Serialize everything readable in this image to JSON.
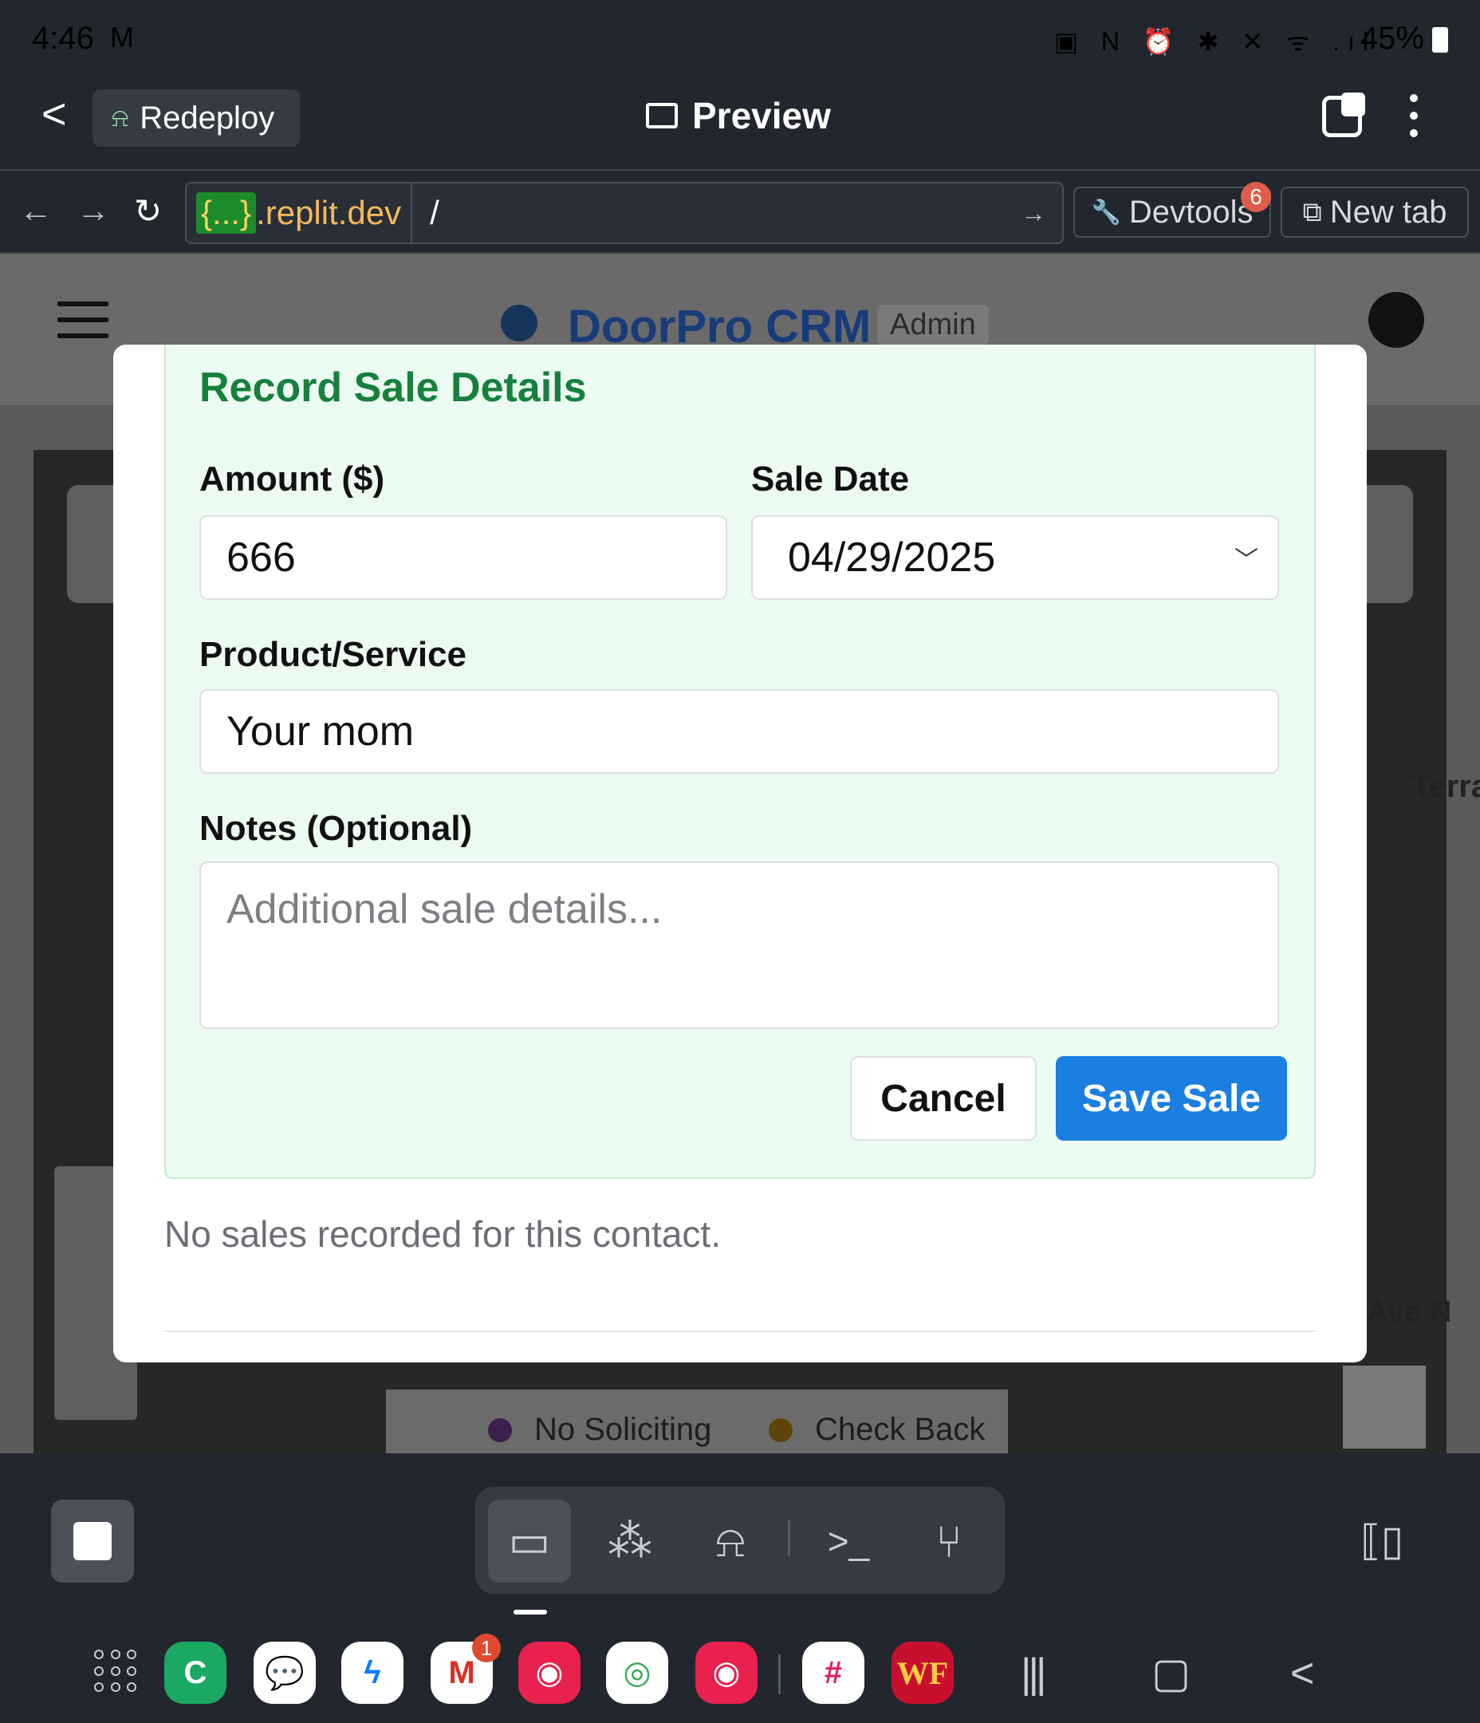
{
  "status_bar": {
    "time": "4:46",
    "mail_glyph": "M",
    "icons": "▣ N ⏰ ✱ ✕ ᯤ .ıl",
    "battery": "45%"
  },
  "app_bar": {
    "back_glyph": "<",
    "redeploy_label": "Redeploy",
    "redeploy_icon": "⍾",
    "preview_title": "Preview"
  },
  "url_bar": {
    "back_glyph": "←",
    "forward_glyph": "→",
    "reload_glyph": "↻",
    "host_tag": "{...}",
    "host_domain": ".replit.dev",
    "path": "/",
    "go_glyph": "→",
    "devtools_label": "Devtools",
    "devtools_icon": "🔧",
    "devtools_badge": "6",
    "newtab_label": "New tab",
    "newtab_icon": "⧉"
  },
  "web_page": {
    "title": "DoorPro CRM",
    "badge": "Admin",
    "side_text": "Terra",
    "side_text2": "Ave N",
    "legend": [
      {
        "label": "No Soliciting",
        "color": "#3b1f4d"
      },
      {
        "label": "Check Back",
        "color": "#5d4409"
      }
    ]
  },
  "modal": {
    "form_title": "Record Sale Details",
    "amount_label": "Amount ($)",
    "amount_value": "666",
    "date_label": "Sale Date",
    "date_value": "04/29/2025",
    "date_chevron": "﹀",
    "product_label": "Product/Service",
    "product_value": "Your mom",
    "notes_label": "Notes (Optional)",
    "notes_placeholder": "Additional sale details...",
    "cancel_label": "Cancel",
    "save_label": "Save Sale",
    "empty_message": "No sales recorded for this contact."
  },
  "taskbar": {
    "tools": [
      {
        "name": "preview",
        "glyph": "▭"
      },
      {
        "name": "workspace",
        "glyph": "⁂"
      },
      {
        "name": "deploy",
        "glyph": "⍾"
      },
      {
        "name": "shell",
        "glyph": ">_"
      },
      {
        "name": "git",
        "glyph": "⑂"
      }
    ],
    "side_panel_glyph": "⟦▯"
  },
  "dock": {
    "apps": [
      {
        "name": "phone",
        "glyph": "C",
        "color": "#1aa862"
      },
      {
        "name": "messages",
        "glyph": "💬",
        "color": "#ffffff"
      },
      {
        "name": "messenger",
        "glyph": "ϟ",
        "color": "#ffffff"
      },
      {
        "name": "gmail",
        "glyph": "M",
        "color": "#ffffff"
      },
      {
        "name": "camera",
        "glyph": "◉",
        "color": "#e8214f"
      },
      {
        "name": "chrome",
        "glyph": "◎",
        "color": "#ffffff"
      },
      {
        "name": "camera2",
        "glyph": "◉",
        "color": "#e8214f"
      },
      {
        "name": "slack",
        "glyph": "#",
        "color": "#ffffff"
      },
      {
        "name": "wells-fargo",
        "glyph": "WF",
        "color": "#c8102e"
      }
    ],
    "gmail_badge": "1",
    "nav_recents": "|||",
    "nav_home": "▢",
    "nav_back": "<"
  }
}
